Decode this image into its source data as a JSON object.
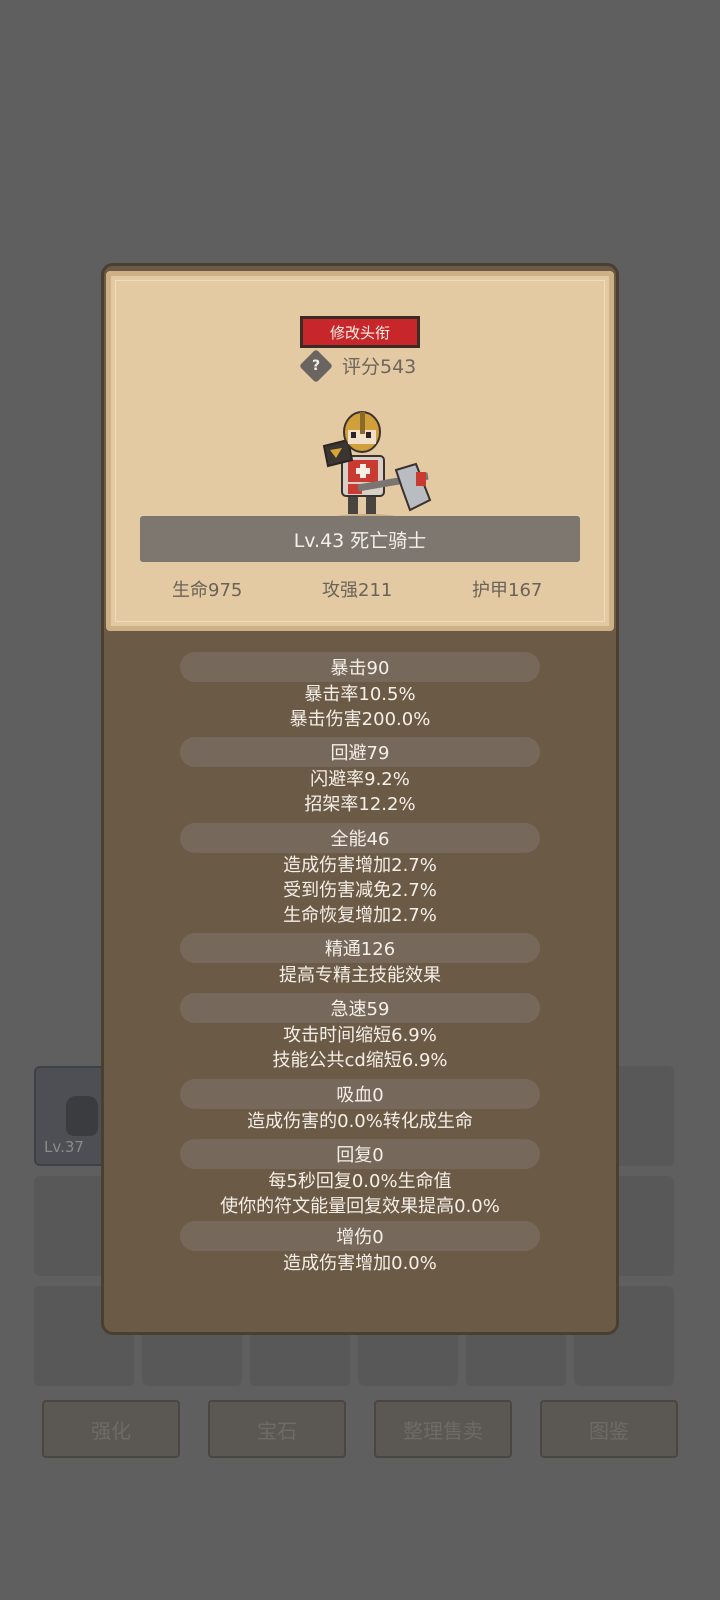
{
  "header": {
    "title_button": "修改头衔",
    "score": "评分543",
    "hero_name": "Lv.43 死亡骑士"
  },
  "base_stats": {
    "hp": "生命975",
    "attack": "攻强211",
    "armor": "护甲167"
  },
  "stats": {
    "crit": "暴击90",
    "crit_rate": "暴击率10.5%",
    "crit_damage": "暴击伤害200.0%",
    "dodge": "回避79",
    "dodge_rate": "闪避率9.2%",
    "parry_rate": "招架率12.2%",
    "versatility": "全能46",
    "vers_damage": "造成伤害增加2.7%",
    "vers_reduction": "受到伤害减免2.7%",
    "vers_heal": "生命恢复增加2.7%",
    "mastery": "精通126",
    "mastery_desc": "提高专精主技能效果",
    "haste": "急速59",
    "haste_attack": "攻击时间缩短6.9%",
    "haste_cd": "技能公共cd缩短6.9%",
    "lifesteal": "吸血0",
    "lifesteal_desc": "造成伤害的0.0%转化成生命",
    "regen": "回复0",
    "regen_hp": "每5秒回复0.0%生命值",
    "regen_rune": "使你的符文能量回复效果提高0.0%",
    "damage_boost": "增伤0",
    "damage_boost_desc": "造成伤害增加0.0%"
  },
  "background": {
    "item_level": "Lv.37",
    "buttons": [
      "强化",
      "宝石",
      "整理售卖",
      "图鉴"
    ]
  },
  "colors": {
    "title_button": "#c7262b",
    "parchment": "#e3caa2",
    "panel": "#6b5a46"
  }
}
